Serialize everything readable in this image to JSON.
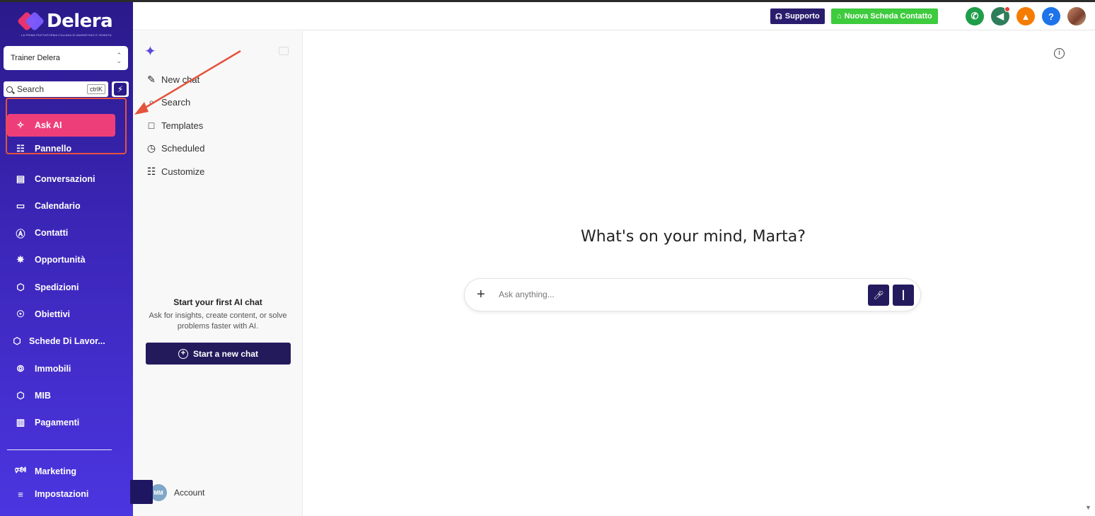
{
  "brand": {
    "name": "Delera",
    "tagline": "LA PRIMA PIATTAFORMA ITALIANA DI MARKETING E VENDITA"
  },
  "location": {
    "selected": "Trainer Delera"
  },
  "sidebar_search": {
    "placeholder": "Search",
    "shortcut": "ctrlK"
  },
  "nav": {
    "items": [
      {
        "label": "Ask AI",
        "icon": "sparkle-icon",
        "active": true
      },
      {
        "label": "Pannello",
        "icon": "grid-icon"
      },
      {
        "label": "Conversazioni",
        "icon": "chat-icon"
      },
      {
        "label": "Calendario",
        "icon": "calendar-icon"
      },
      {
        "label": "Contatti",
        "icon": "contact-icon"
      },
      {
        "label": "Opportunità",
        "icon": "opportunity-icon"
      },
      {
        "label": "Spedizioni",
        "icon": "box-icon"
      },
      {
        "label": "Obiettivi",
        "icon": "bulb-icon"
      },
      {
        "label": "Schede Di Lavor...",
        "icon": "box-icon"
      },
      {
        "label": "Immobili",
        "icon": "building-icon"
      },
      {
        "label": "MIB",
        "icon": "box-icon"
      },
      {
        "label": "Pagamenti",
        "icon": "receipt-icon"
      }
    ],
    "bottom": [
      {
        "label": "Marketing",
        "icon": "megaphone-icon"
      },
      {
        "label": "Impostazioni",
        "icon": "sliders-icon"
      }
    ]
  },
  "header": {
    "support_label": "Supporto",
    "new_contact_label": "Nuova Scheda Contatto",
    "colors": {
      "support": "#2a1d6d",
      "new_contact": "#3ecb3e",
      "phone": "#1e9e4a",
      "megaphone": "#2e7d5b",
      "bell": "#f57c00",
      "help": "#1e74e8"
    }
  },
  "chat_panel": {
    "menu": [
      {
        "label": "New chat",
        "icon": "edit-icon"
      },
      {
        "label": "Search",
        "icon": "search-icon"
      },
      {
        "label": "Templates",
        "icon": "book-icon"
      },
      {
        "label": "Scheduled",
        "icon": "clock-icon"
      },
      {
        "label": "Customize",
        "icon": "grid-icon"
      }
    ],
    "empty_title": "Start your first AI chat",
    "empty_text": "Ask for insights, create content, or solve problems faster with AI.",
    "start_button": "Start a new chat",
    "account_initials": "MM",
    "account_label": "Account"
  },
  "main": {
    "greeting": "What's on your mind, Marta?",
    "prompt_placeholder": "Ask anything..."
  }
}
